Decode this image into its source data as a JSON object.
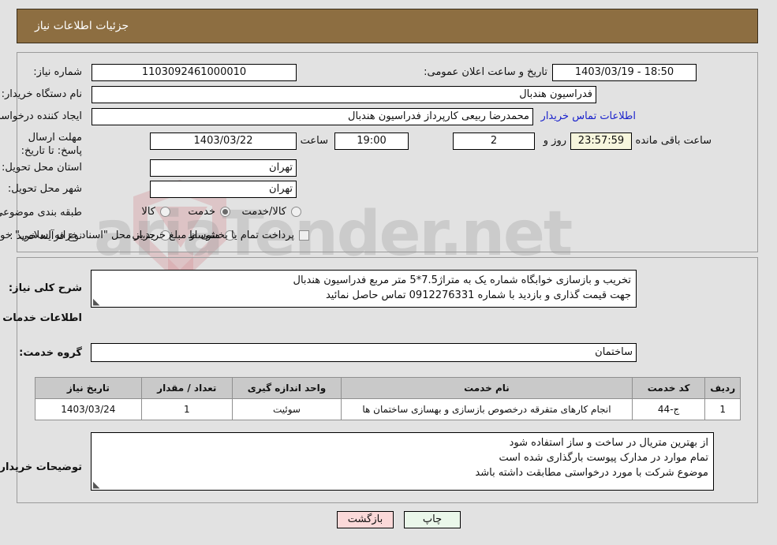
{
  "header": {
    "title": "جزئیات اطلاعات نیاز",
    "bg": "#8d6e41"
  },
  "watermark": {
    "text": "ariaTender.net"
  },
  "top_form": {
    "need_number": {
      "label": "شماره نیاز:",
      "value": "1103092461000010"
    },
    "public_announce": {
      "label": "تاریخ و ساعت اعلان عمومی:",
      "value": "18:50 - 1403/03/19"
    },
    "buyer_org": {
      "label": "نام دستگاه خریدار:",
      "value": "فدراسیون هندبال"
    },
    "requester": {
      "label": "ایجاد کننده درخواست:",
      "value": "محمدرضا ربیعی کارپرداز فدراسیون هندبال"
    },
    "contact_link": "اطلاعات تماس خریدار",
    "deadline": {
      "label": "مهلت ارسال پاسخ: تا تاریخ:",
      "date": "1403/03/22",
      "hour_label": "ساعت",
      "hour": "19:00",
      "days": "2",
      "days_label": "روز و",
      "countdown": "23:57:59",
      "remaining_label": "ساعت باقی مانده"
    },
    "province": {
      "label": "استان محل تحویل:",
      "value": "تهران"
    },
    "city": {
      "label": "شهر محل تحویل:",
      "value": "تهران"
    },
    "category": {
      "label": "طبقه بندی موضوعی:",
      "options": [
        "کالا",
        "خدمت",
        "کالا/خدمت"
      ],
      "selected": "خدمت"
    },
    "process_type": {
      "label": "نوع فرآیند خرید :",
      "options": [
        "جزیی",
        "متوسط"
      ],
      "selected": "",
      "checkbox_label": "پرداخت تمام یا بخشی از مبلغ خرید،از محل \"اسناد خزانه اسلامی\" خواهد بود.",
      "checkbox_checked": false
    }
  },
  "mid": {
    "need_desc": {
      "label": "شرح کلی نیاز:",
      "line1": "تخریب و بازسازی خوابگاه شماره یک به متراژ7.5*5 متر مربع فدراسیون هندبال",
      "line2": "جهت قیمت گذاری و بازدید با شماره 0912276331 تماس حاصل نمائید"
    },
    "services_heading": "اطلاعات خدمات مورد نیاز",
    "service_group": {
      "label": "گروه خدمت:",
      "value": "ساختمان"
    },
    "table": {
      "columns": [
        "ردیف",
        "کد خدمت",
        "نام خدمت",
        "واحد اندازه گیری",
        "تعداد / مقدار",
        "تاریخ نیاز"
      ],
      "rows": [
        {
          "row": "1",
          "code": "ج-44",
          "name": "انجام کارهای متفرقه درخصوص بازسازی و بهسازی ساختمان ها",
          "unit": "سوئیت",
          "qty": "1",
          "date": "1403/03/24"
        }
      ]
    },
    "buyer_notes": {
      "label": "توضیحات خریدار:",
      "line1": "از بهترین متریال در ساخت و ساز استفاده شود",
      "line2": "تمام موارد در مدارک پیوست بارگذاری شده است",
      "line3": "موضوع شرکت با مورد درخواستی مطابقت داشته باشد"
    }
  },
  "footer": {
    "print": "چاپ",
    "back": "بازگشت"
  }
}
